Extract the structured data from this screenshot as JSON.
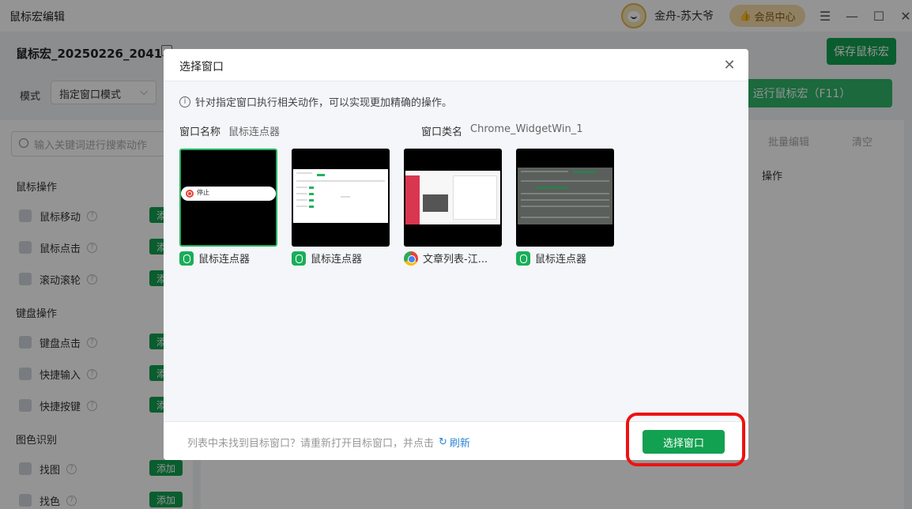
{
  "app": {
    "title": "鼠标宏编辑",
    "user_name": "金舟-苏大爷",
    "vip_label": "会员中心",
    "window_controls": [
      "menu-icon",
      "minimize-icon",
      "maximize-icon",
      "close-icon"
    ]
  },
  "macro": {
    "name": "鼠标宏_20250226_2041",
    "save_label": "保存鼠标宏"
  },
  "mode": {
    "label": "模式",
    "selected": "指定窗口模式",
    "run_label": "运行鼠标宏（F11）"
  },
  "left_panel": {
    "search_placeholder": "输入关键词进行搜索动作",
    "groups": [
      {
        "title": "鼠标操作",
        "items": [
          {
            "label": "鼠标移动",
            "add": "添加"
          },
          {
            "label": "鼠标点击",
            "add": "添加"
          },
          {
            "label": "滚动滚轮",
            "add": "添加"
          }
        ]
      },
      {
        "title": "键盘操作",
        "items": [
          {
            "label": "键盘点击",
            "add": "添加"
          },
          {
            "label": "快捷输入",
            "add": "添加"
          },
          {
            "label": "快捷按键",
            "add": "添加"
          }
        ]
      },
      {
        "title": "图色识别",
        "items": [
          {
            "label": "找图",
            "add": "添加"
          },
          {
            "label": "找色",
            "add": "添加"
          }
        ]
      }
    ]
  },
  "right_panel": {
    "batch_edit": "批量编辑",
    "clear": "清空",
    "op_header": "操作"
  },
  "modal": {
    "title": "选择窗口",
    "info": "针对指定窗口执行相关动作，可以实现更加精确的操作。",
    "window_name_label": "窗口名称",
    "window_name_value": "鼠标连点器",
    "window_class_label": "窗口类名",
    "window_class_value": "Chrome_WidgetWin_1",
    "windows": [
      {
        "caption": "鼠标连点器",
        "icon": "mouse-clicker-app-icon",
        "selected": true,
        "preview_text": "停止"
      },
      {
        "caption": "鼠标连点器",
        "icon": "mouse-clicker-app-icon",
        "selected": false
      },
      {
        "caption": "文章列表-江...",
        "icon": "chrome-icon",
        "selected": false
      },
      {
        "caption": "鼠标连点器",
        "icon": "mouse-clicker-app-icon",
        "selected": false
      }
    ],
    "footer_tip": "列表中未找到目标窗口？请重新打开目标窗口，并点击",
    "refresh_label": "刷新",
    "confirm_label": "选择窗口",
    "highlight_color": "#ee1111",
    "accent_color": "#12a150"
  }
}
